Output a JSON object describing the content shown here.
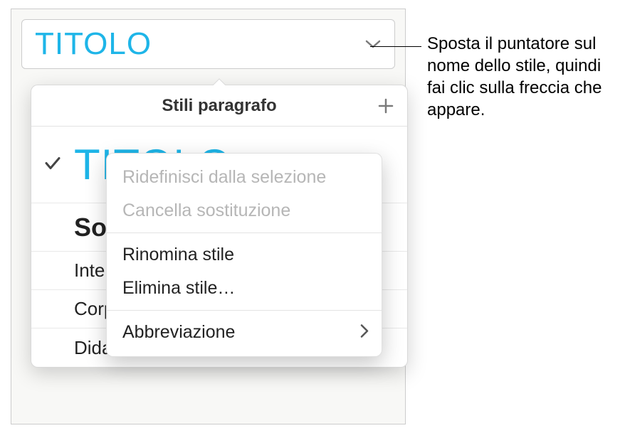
{
  "selector": {
    "title": "Titolo"
  },
  "popover": {
    "header": "Stili paragrafo",
    "items": [
      {
        "label": "Titolo",
        "kind": "titolo",
        "checked": true
      },
      {
        "label": "Sot",
        "kind": "sot",
        "checked": false
      },
      {
        "label": "Inte",
        "kind": "std",
        "checked": false
      },
      {
        "label": "Corp",
        "kind": "std",
        "checked": false
      },
      {
        "label": "Didascalia",
        "kind": "std",
        "checked": false
      }
    ]
  },
  "context_menu": {
    "redefine": "Ridefinisci dalla selezione",
    "clear": "Cancella sostituzione",
    "rename": "Rinomina stile",
    "delete": "Elimina stile…",
    "abbrev": "Abbreviazione"
  },
  "callout": {
    "text": "Sposta il puntatore sul nome dello stile, quindi fai clic sulla freccia che appare."
  }
}
